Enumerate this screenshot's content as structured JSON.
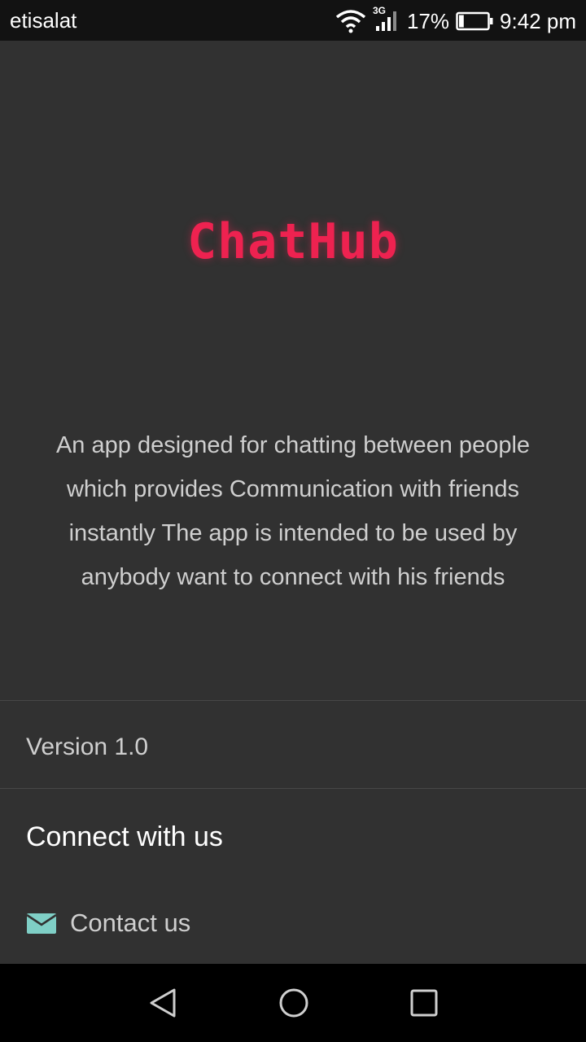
{
  "status_bar": {
    "carrier": "etisalat",
    "network_type": "3G",
    "battery_percent": "17%",
    "battery_level": 0.17,
    "time": "9:42 pm",
    "icons": [
      "wifi-icon",
      "signal-icon",
      "battery-icon"
    ]
  },
  "about": {
    "logo": "ChatHub",
    "description": "An app designed for chatting between people which provides Communication with friends instantly The app is intended to be used by anybody want to connect with his friends",
    "version": "Version 1.0",
    "connect_heading": "Connect with us",
    "contact_label": "Contact us",
    "contact_icon": "email-icon"
  },
  "nav_bar": {
    "icons": [
      "back-icon",
      "home-icon",
      "recents-icon"
    ]
  },
  "colors": {
    "background": "#313131",
    "status_bar": "#121212",
    "logo": "#ee2250",
    "contact_icon": "#7fcfc6",
    "text_primary": "#ffffff",
    "text_secondary": "#cfcfcf",
    "nav_bar": "#000000"
  }
}
